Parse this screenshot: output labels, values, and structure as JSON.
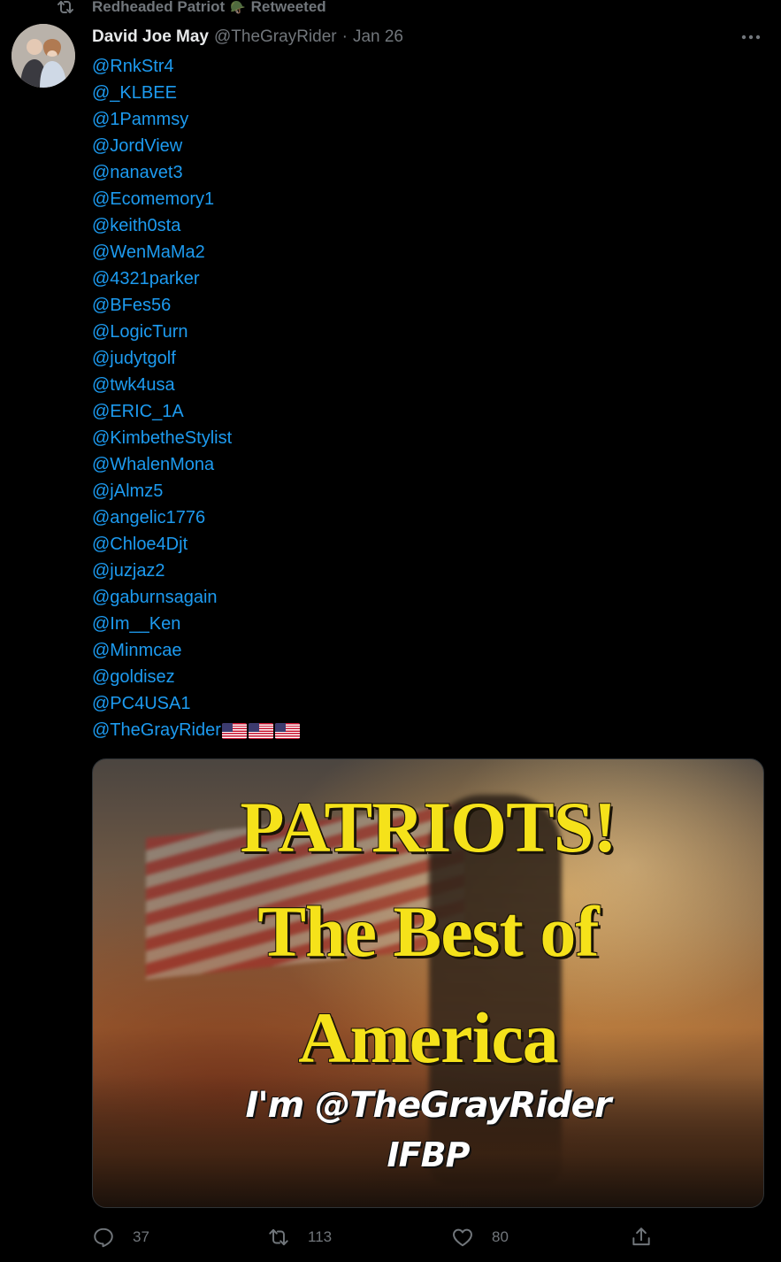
{
  "retweet_banner": {
    "retweeter_name": "Redheaded Patriot",
    "retweeter_emoji": "🪖",
    "label": "Retweeted"
  },
  "tweet": {
    "author_name": "David Joe May",
    "handle": "@TheGrayRider",
    "separator": "·",
    "date": "Jan 26",
    "more_icon": "more-horizontal-icon",
    "mentions": [
      "@RnkStr4",
      "@_KLBEE",
      "@1Pammsy",
      "@JordView",
      "@nanavet3",
      "@Ecomemory1",
      "@keith0sta",
      "@WenMaMa2",
      "@4321parker",
      "@BFes56",
      "@LogicTurn",
      "@judytgolf",
      "@twk4usa",
      "@ERIC_1A",
      "@KimbetheStylist",
      "@WhalenMona",
      "@jAlmz5",
      "@angelic1776",
      "@Chloe4Djt",
      "@juzjaz2",
      "@gaburnsagain",
      "@Im__Ken",
      "@Minmcae",
      "@goldisez",
      "@PC4USA1",
      "@TheGrayRider"
    ],
    "last_mention_flags": 3
  },
  "media": {
    "line1": "PATRIOTS!",
    "line2": "The Best of",
    "line3": "America",
    "line4": "I'm @TheGrayRider",
    "line5": "IFBP"
  },
  "actions": {
    "reply_count": "37",
    "retweet_count": "113",
    "like_count": "80"
  },
  "colors": {
    "background": "#000000",
    "text_primary": "#e7e9ea",
    "text_secondary": "#71767b",
    "link": "#1d9bf0",
    "headline_yellow": "#f5e21a"
  }
}
